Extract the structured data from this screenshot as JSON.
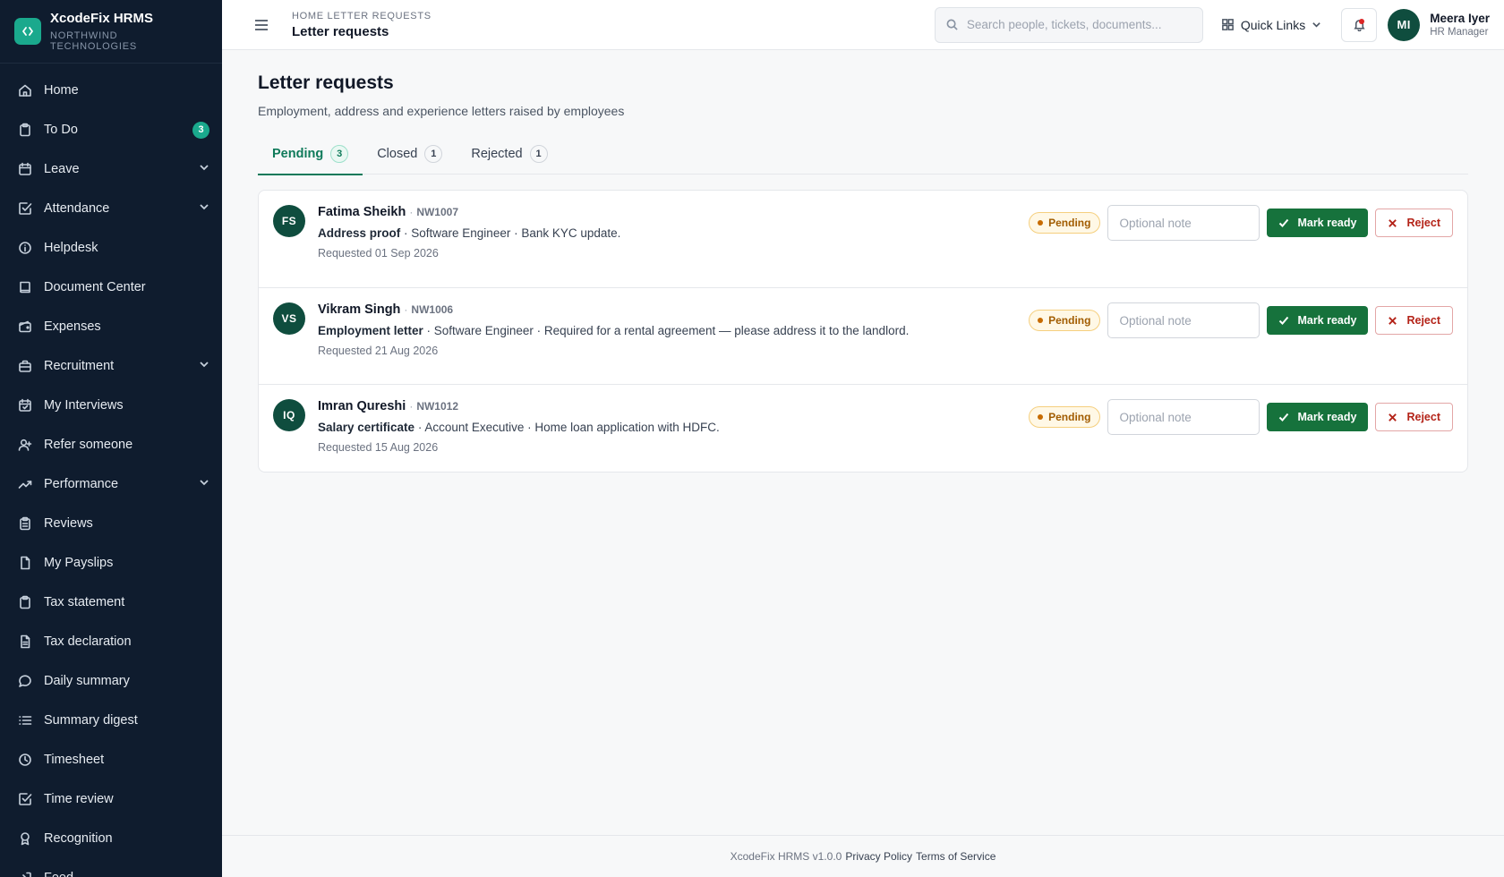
{
  "brand": {
    "name": "XcodeFix HRMS",
    "org": "NORTHWIND TECHNOLOGIES"
  },
  "sidebar": {
    "items": [
      {
        "label": "Home",
        "icon": "home-icon"
      },
      {
        "label": "To Do",
        "icon": "clipboard-icon",
        "badge": "3"
      },
      {
        "label": "Leave",
        "icon": "calendar-icon",
        "chevron": true
      },
      {
        "label": "Attendance",
        "icon": "check-square-icon",
        "chevron": true
      },
      {
        "label": "Helpdesk",
        "icon": "info-icon"
      },
      {
        "label": "Document Center",
        "icon": "book-icon"
      },
      {
        "label": "Expenses",
        "icon": "wallet-icon"
      },
      {
        "label": "Recruitment",
        "icon": "briefcase-icon",
        "chevron": true
      },
      {
        "label": "My Interviews",
        "icon": "calendar-check-icon"
      },
      {
        "label": "Refer someone",
        "icon": "user-plus-icon"
      },
      {
        "label": "Performance",
        "icon": "trending-up-icon",
        "chevron": true
      },
      {
        "label": "Reviews",
        "icon": "clipboard-list-icon"
      },
      {
        "label": "My Payslips",
        "icon": "file-icon"
      },
      {
        "label": "Tax statement",
        "icon": "clipboard-icon"
      },
      {
        "label": "Tax declaration",
        "icon": "file-text-icon"
      },
      {
        "label": "Daily summary",
        "icon": "message-circle-icon"
      },
      {
        "label": "Summary digest",
        "icon": "list-icon"
      },
      {
        "label": "Timesheet",
        "icon": "clock-icon"
      },
      {
        "label": "Time review",
        "icon": "check-square-icon"
      },
      {
        "label": "Recognition",
        "icon": "award-icon"
      },
      {
        "label": "Feed",
        "icon": "log-in-icon"
      }
    ]
  },
  "topbar": {
    "breadcrumb": "HOME LETTER REQUESTS",
    "title": "Letter requests",
    "search_placeholder": "Search people, tickets, documents...",
    "quick_links": "Quick Links",
    "user": {
      "initials": "MI",
      "name": "Meera Iyer",
      "role": "HR Manager"
    }
  },
  "page": {
    "title": "Letter requests",
    "subtitle": "Employment, address and experience letters raised by employees"
  },
  "tabs": [
    {
      "label": "Pending",
      "count": "3",
      "active": true
    },
    {
      "label": "Closed",
      "count": "1",
      "active": false
    },
    {
      "label": "Rejected",
      "count": "1",
      "active": false
    }
  ],
  "requests": [
    {
      "initials": "FS",
      "name": "Fatima Sheikh",
      "code": "NW1007",
      "type": "Address proof",
      "details": " · Software Engineer · Bank KYC update.",
      "requested": "Requested 01 Sep 2026",
      "status": "Pending",
      "note_placeholder": "Optional note",
      "ready_label": "Mark ready",
      "reject_label": "Reject"
    },
    {
      "initials": "VS",
      "name": "Vikram Singh",
      "code": "NW1006",
      "type": "Employment letter",
      "details": " · Software Engineer · Required for a rental agreement — please address it to the landlord.",
      "requested": "Requested 21 Aug 2026",
      "status": "Pending",
      "note_placeholder": "Optional note",
      "ready_label": "Mark ready",
      "reject_label": "Reject"
    },
    {
      "initials": "IQ",
      "name": "Imran Qureshi",
      "code": "NW1012",
      "type": "Salary certificate",
      "details": " · Account Executive · Home loan application with HDFC.",
      "requested": "Requested 15 Aug 2026",
      "status": "Pending",
      "note_placeholder": "Optional note",
      "ready_label": "Mark ready",
      "reject_label": "Reject"
    }
  ],
  "footer": {
    "version": "XcodeFix HRMS v1.0.0",
    "privacy": "Privacy Policy",
    "terms": "Terms of Service"
  },
  "colors": {
    "sidebar_bg": "#0f1c2e",
    "accent": "#1aa98d",
    "primary_button": "#16723c",
    "reject": "#b42318",
    "pending": "#a15c00"
  }
}
